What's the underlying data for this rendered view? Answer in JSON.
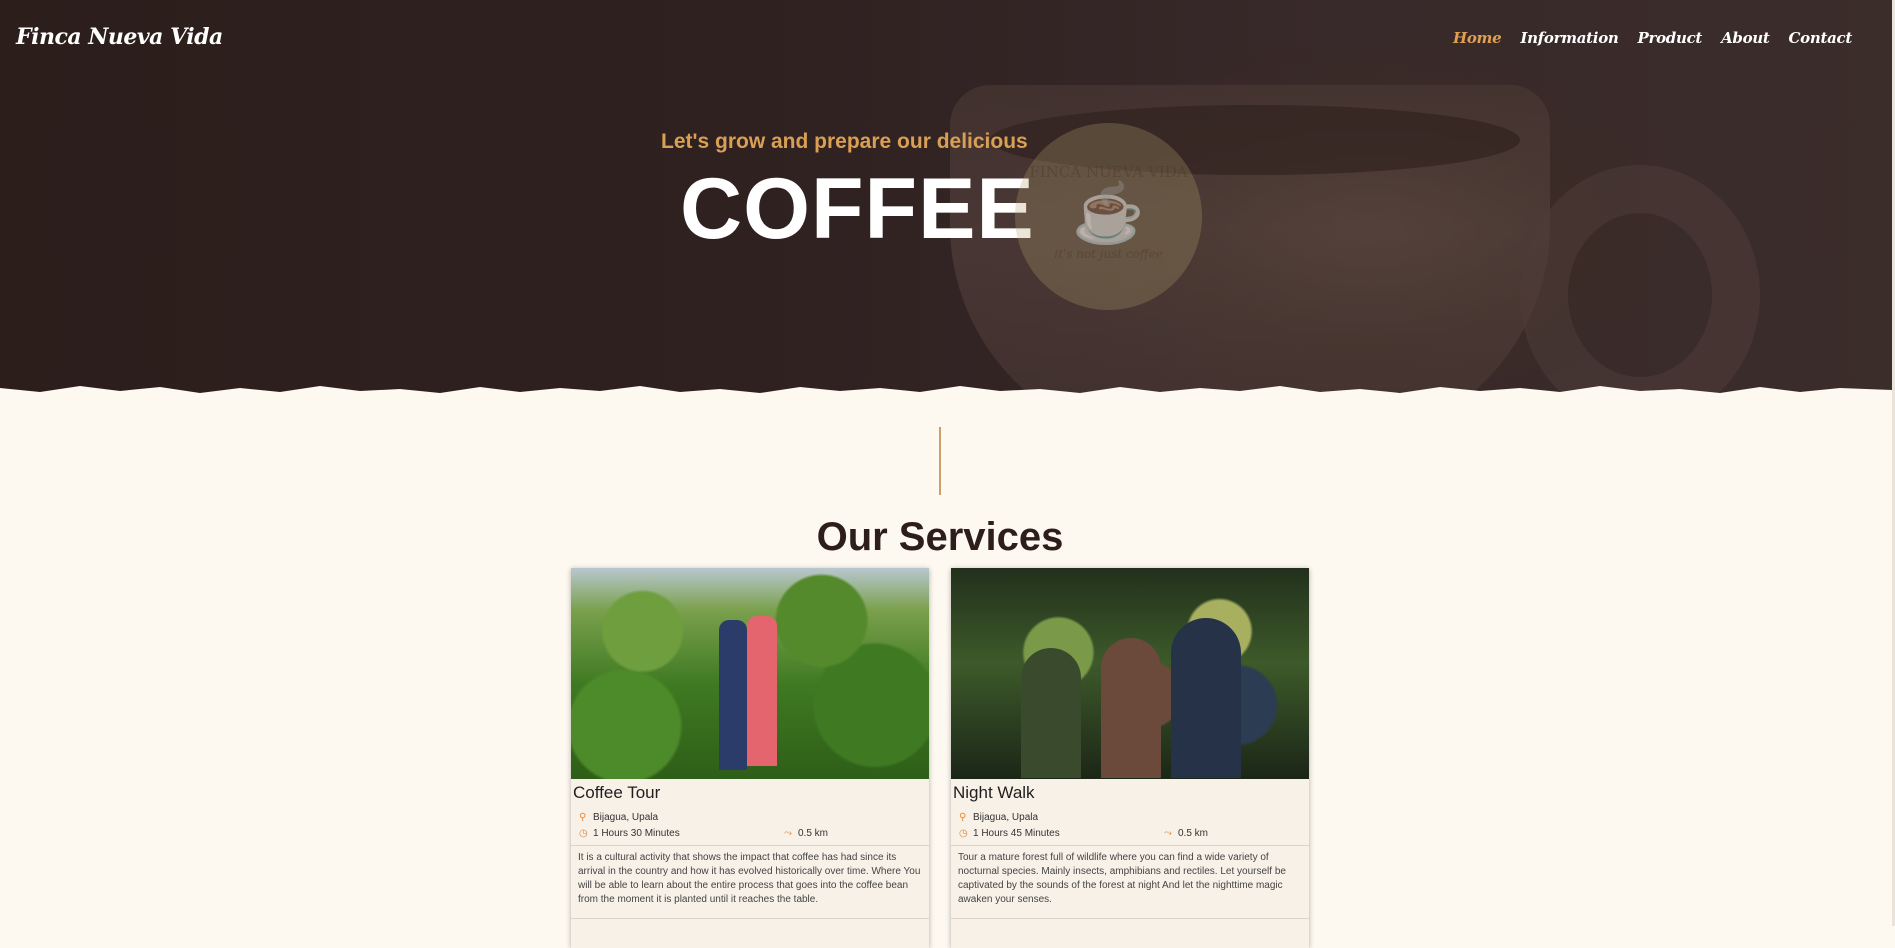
{
  "header": {
    "brand": "Finca Nueva Vida",
    "nav": [
      {
        "label": "Home",
        "active": true
      },
      {
        "label": "Information",
        "active": false
      },
      {
        "label": "Product",
        "active": false
      },
      {
        "label": "About",
        "active": false
      },
      {
        "label": "Contact",
        "active": false
      }
    ]
  },
  "hero": {
    "subtitle": "Let's grow and prepare our delicious",
    "title": "COFFEE",
    "logo_text_top": "FINCA NUEVA VIDA",
    "logo_text_bottom": "it's not just coffee"
  },
  "services": {
    "title": "Our Services",
    "cards": [
      {
        "name": "Coffee Tour",
        "location": "Bijagua, Upala",
        "duration": "1 Hours 30 Minutes",
        "distance": "0.5 km",
        "description": "It is a cultural activity that shows the impact that coffee has had since its arrival in the country and how it has evolved historically over time. Where You will be able to learn about the entire process that goes into the coffee bean from the moment it is planted until it reaches the table."
      },
      {
        "name": "Night Walk",
        "location": "Bijagua, Upala",
        "duration": "1 Hours 45 Minutes",
        "distance": "0.5 km",
        "description": "Tour a mature forest full of wildlife where you can find a wide variety of nocturnal species. Mainly insects, amphibians and rectiles. Let yourself be captivated by the sounds of the forest at night And let the nighttime magic awaken your senses."
      }
    ]
  },
  "colors": {
    "accent": "#e0a052",
    "hero_bg": "#2f2120",
    "page_bg": "#fdf8f0",
    "icon": "#e08a3c"
  }
}
